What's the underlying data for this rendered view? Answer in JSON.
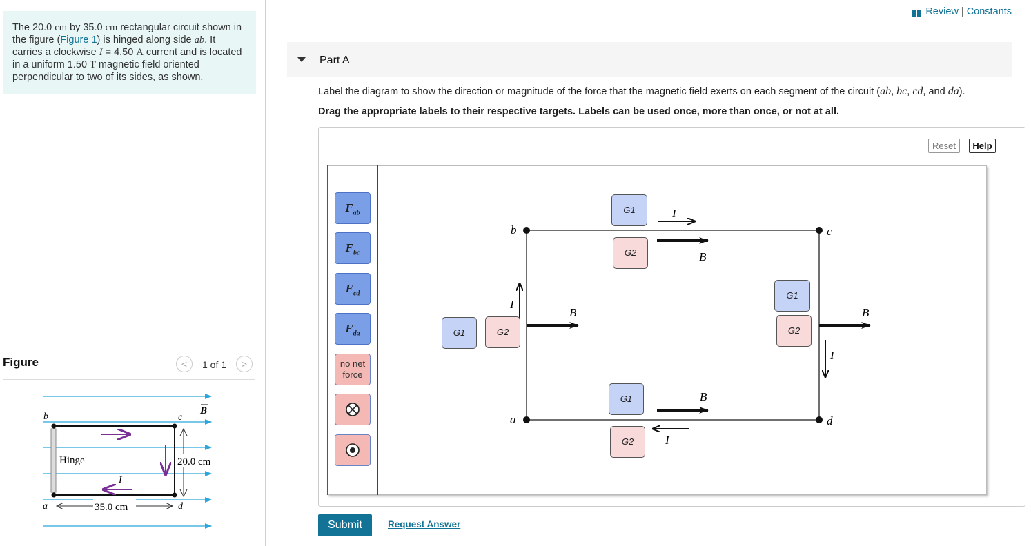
{
  "intro": {
    "p1": "The 20.0 ",
    "u1": "cm",
    "p2": " by 35.0 ",
    "u2": "cm",
    "p3": " rectangular circuit shown in the figure (",
    "link": "Figure 1",
    "p4": ")  is hinged along side ",
    "side": "ab",
    "p5": ".  It carries a clockwise ",
    "cur": "I",
    "p6": " = 4.50 ",
    "u3": "A",
    "p7": " current and is located in a uniform 1.50 ",
    "u4": "T",
    "p8": " magnetic field oriented perpendicular to two of its sides, as shown."
  },
  "figure": {
    "title": "Figure",
    "count": "1 of 1",
    "prev_glyph": "<",
    "next_glyph": ">",
    "labels": {
      "b": "b",
      "c": "c",
      "a": "a",
      "d": "d",
      "B": "B",
      "hinge": "Hinge",
      "I": "I",
      "dim_h": "20.0 cm",
      "dim_w": "35.0 cm"
    }
  },
  "header": {
    "review": "Review",
    "sep": "|",
    "constants": "Constants"
  },
  "part": {
    "title": "Part A",
    "prompt_pre": "Label the diagram to show the direction or magnitude of the force that the magnetic field exerts on each segment of the circuit (",
    "seg_ab": "ab",
    "seg_bc": "bc",
    "seg_cd": "cd",
    "seg_da": "da",
    "comma": ", ",
    "and": ", and ",
    "prompt_post": ").",
    "instructions": "Drag the appropriate labels to their respective targets. Labels can be used once, more than once, or not at all."
  },
  "controls": {
    "reset": "Reset",
    "help": "Help",
    "submit": "Submit",
    "request": "Request Answer"
  },
  "labels": [
    {
      "main": "F",
      "sub": "ab"
    },
    {
      "main": "F",
      "sub": "bc"
    },
    {
      "main": "F",
      "sub": "cd"
    },
    {
      "main": "F",
      "sub": "da"
    },
    {
      "text1": "no net",
      "text2": "force"
    }
  ],
  "targets": {
    "g1": "G1",
    "g2": "G2"
  },
  "diagram": {
    "b": "b",
    "c": "c",
    "a": "a",
    "d": "d",
    "I": "I",
    "B": "B"
  },
  "colors": {
    "accent": "#137397",
    "label_blue": "#7b9fe6",
    "label_red": "#f4b9b4",
    "target_blue": "#c5d3f7",
    "target_red": "#f8dada",
    "field_line": "#2aa6dc",
    "current_arrow": "#7a2e96"
  }
}
